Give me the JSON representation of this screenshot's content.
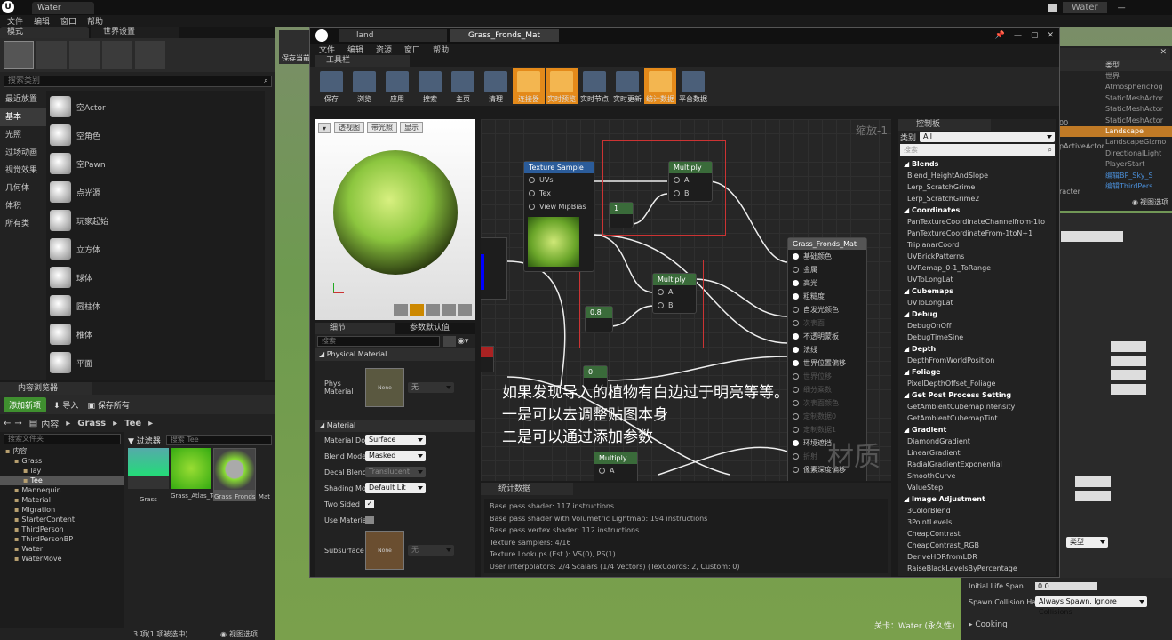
{
  "app": {
    "title": "Water",
    "top_right": "Water"
  },
  "main_menu": [
    "文件",
    "编辑",
    "窗口",
    "帮助"
  ],
  "modes": {
    "tab": "模式",
    "world_tab": "世界设置",
    "search_placeholder": "搜索类别",
    "categories": [
      "最近放置",
      "基本",
      "光照",
      "过场动画",
      "视觉效果",
      "几何体",
      "体积",
      "所有类"
    ],
    "items": [
      "空Actor",
      "空角色",
      "空Pawn",
      "点光源",
      "玩家起始",
      "立方体",
      "球体",
      "圆柱体",
      "椎体",
      "平面"
    ]
  },
  "content": {
    "tab": "内容浏览器",
    "add_new": "添加新项",
    "import": "导入",
    "save_all": "保存所有",
    "crumbs": [
      "内容",
      "Grass",
      "Tee"
    ],
    "search_folders": "搜索文件夹",
    "filters": "过滤器",
    "search_assets": "搜索 Tee",
    "tree": [
      {
        "label": "内容",
        "d": 0
      },
      {
        "label": "Grass",
        "d": 1
      },
      {
        "label": "lay",
        "d": 2
      },
      {
        "label": "Tee",
        "d": 2
      },
      {
        "label": "Mannequin",
        "d": 1
      },
      {
        "label": "Material",
        "d": 1
      },
      {
        "label": "Migration",
        "d": 1
      },
      {
        "label": "StarterContent",
        "d": 1
      },
      {
        "label": "ThirdPerson",
        "d": 1
      },
      {
        "label": "ThirdPersonBP",
        "d": 1
      },
      {
        "label": "Water",
        "d": 1
      },
      {
        "label": "WaterMove",
        "d": 1
      }
    ],
    "assets": [
      {
        "name": "Grass"
      },
      {
        "name": "Grass_Atlas_Tex"
      },
      {
        "name": "Grass_Fronds_Mat"
      }
    ],
    "status": "3 项(1 项被选中)",
    "view_options": "视图选项"
  },
  "editor": {
    "tabs": [
      "land",
      "Grass_Fronds_Mat"
    ],
    "menu": [
      "文件",
      "编辑",
      "资源",
      "窗口",
      "帮助"
    ],
    "toolbar_tab": "工具栏",
    "toolbar": [
      {
        "label": "保存",
        "active": false
      },
      {
        "label": "浏览",
        "active": false
      },
      {
        "label": "应用",
        "active": false
      },
      {
        "label": "搜索",
        "active": false
      },
      {
        "label": "主页",
        "active": false
      },
      {
        "label": "清理",
        "active": false
      },
      {
        "label": "连接器",
        "active": true
      },
      {
        "label": "实时预览",
        "active": true
      },
      {
        "label": "实时节点",
        "active": false
      },
      {
        "label": "实时更新",
        "active": false
      },
      {
        "label": "统计数据",
        "active": true
      },
      {
        "label": "平台数据",
        "active": false
      }
    ],
    "viewport_buttons": [
      "透视图",
      "带光照",
      "显示"
    ],
    "zoom": "缩放-1",
    "watermark": "材质",
    "annotation": [
      "如果发现导入的植物有白边过于明亮等等。",
      "一是可以去调整贴图本身",
      "二是可以通过添加参数"
    ],
    "nodes": {
      "texture": {
        "title": "Texture Sample",
        "pins": [
          "UVs",
          "Tex",
          "View MipBias"
        ]
      },
      "multiply1": {
        "title": "Multiply",
        "a": "A",
        "b": "B"
      },
      "multiply2": {
        "title": "Multiply",
        "a": "A",
        "b": "B"
      },
      "multiply3": {
        "title": "Multiply",
        "a": "A"
      },
      "const1": "1",
      "const2": "0.8",
      "const3": "0",
      "result": {
        "title": "Grass_Fronds_Mat",
        "pins": [
          "基础颜色",
          "金属",
          "高光",
          "粗糙度",
          "自发光颜色",
          "次表面",
          "不透明蒙板",
          "法线",
          "世界位置偏移",
          "世界位移",
          "细分乘数",
          "次表面颜色",
          "定制数据0",
          "定制数据1",
          "环境遮挡",
          "折射",
          "像素深度偏移"
        ]
      }
    },
    "details": {
      "tab": "细节",
      "params_tab": "参数默认值",
      "search": "搜索",
      "phys_section": "Physical Material",
      "phys_label": "Phys Material",
      "none": "None",
      "none_cn": "无",
      "mat_section": "Material",
      "props": [
        {
          "label": "Material Domain",
          "value": "Surface"
        },
        {
          "label": "Blend Mode",
          "value": "Masked"
        },
        {
          "label": "Decal Blend Mode",
          "value": "Translucent"
        },
        {
          "label": "Shading Model",
          "value": "Default Lit"
        }
      ],
      "two_sided": "Two Sided",
      "use_mat": "Use Material Attributes",
      "subsurface": "Subsurface Profile"
    },
    "stats": {
      "tab": "统计数据",
      "lines": [
        "Base pass shader: 117 instructions",
        "Base pass shader with Volumetric Lightmap: 194 instructions",
        "Base pass vertex shader: 112 instructions",
        "Texture samplers: 4/16",
        "Texture Lookups (Est.): VS(0), PS(1)",
        "User interpolators: 2/4 Scalars (1/4 Vectors) (TexCoords: 2, Custom: 0)"
      ]
    },
    "palette": {
      "tab": "控制板",
      "cat_label": "类别",
      "cat_value": "All",
      "search": "搜索",
      "entries": [
        {
          "t": "c",
          "v": "Blends"
        },
        {
          "t": "i",
          "v": "Blend_HeightAndSlope"
        },
        {
          "t": "i",
          "v": "Lerp_ScratchGrime"
        },
        {
          "t": "i",
          "v": "Lerp_ScratchGrime2"
        },
        {
          "t": "c",
          "v": "Coordinates"
        },
        {
          "t": "i",
          "v": "PanTextureCoordinateChannelfrom-1to"
        },
        {
          "t": "i",
          "v": "PanTextureCoordinateFrom-1toN+1"
        },
        {
          "t": "i",
          "v": "TriplanarCoord"
        },
        {
          "t": "i",
          "v": "UVBrickPatterns"
        },
        {
          "t": "i",
          "v": "UVRemap_0-1_ToRange"
        },
        {
          "t": "i",
          "v": "UVToLongLat"
        },
        {
          "t": "c",
          "v": "Cubemaps"
        },
        {
          "t": "i",
          "v": "UVToLongLat"
        },
        {
          "t": "c",
          "v": "Debug"
        },
        {
          "t": "i",
          "v": "DebugOnOff"
        },
        {
          "t": "i",
          "v": "DebugTimeSine"
        },
        {
          "t": "c",
          "v": "Depth"
        },
        {
          "t": "i",
          "v": "DepthFromWorldPosition"
        },
        {
          "t": "c",
          "v": "Foliage"
        },
        {
          "t": "i",
          "v": "PixelDepthOffset_Foliage"
        },
        {
          "t": "c",
          "v": "Get Post Process Setting"
        },
        {
          "t": "i",
          "v": "GetAmbientCubemapIntensity"
        },
        {
          "t": "i",
          "v": "GetAmbientCubemapTint"
        },
        {
          "t": "c",
          "v": "Gradient"
        },
        {
          "t": "i",
          "v": "DiamondGradient"
        },
        {
          "t": "i",
          "v": "LinearGradient"
        },
        {
          "t": "i",
          "v": "RadialGradientExponential"
        },
        {
          "t": "i",
          "v": "SmoothCurve"
        },
        {
          "t": "i",
          "v": "ValueStep"
        },
        {
          "t": "c",
          "v": "Image Adjustment"
        },
        {
          "t": "i",
          "v": "3ColorBlend"
        },
        {
          "t": "i",
          "v": "3PointLevels"
        },
        {
          "t": "i",
          "v": "CheapContrast"
        },
        {
          "t": "i",
          "v": "CheapContrast_RGB"
        },
        {
          "t": "i",
          "v": "DeriveHDRfromLDR"
        },
        {
          "t": "i",
          "v": "RaiseBlackLevelsByPercentage"
        }
      ]
    }
  },
  "viewport": {
    "save_current": "保存当前",
    "bottom_label": "关卡：Water (永久性)"
  },
  "outliner": {
    "type_header": "类型",
    "types": [
      "世界",
      "AtmosphericFog",
      "StaticMeshActor",
      "StaticMeshActor",
      "StaticMeshActor",
      "Landscape",
      "LandscapeGizmo",
      "DirectionalLight",
      "PlayerStart",
      "编辑BP_Sky_S",
      "编辑ThirdPers"
    ],
    "partial": [
      "00",
      "pActiveActor",
      "racter"
    ],
    "view_options": "视图选项"
  },
  "right_details": {
    "initial_life_span_label": "Initial Life Span",
    "initial_life_span": "0.0",
    "spawn_label": "Spawn Collision Handling",
    "spawn_value": "Always Spawn, Ignore Collisions",
    "cooking": "Cooking",
    "type_dd": "类型"
  }
}
